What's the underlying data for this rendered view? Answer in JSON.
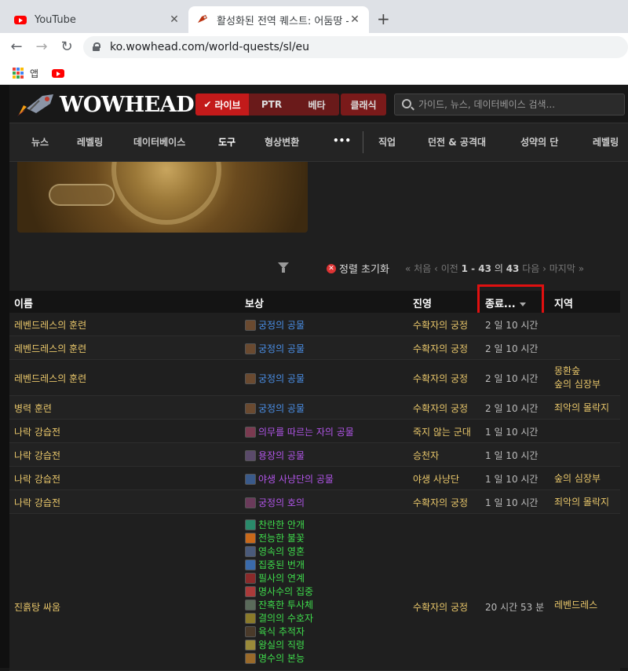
{
  "browser": {
    "tabs": [
      {
        "title": "YouTube",
        "icon": "youtube-icon"
      },
      {
        "title": "활성화된 전역 퀘스트: 어둠땅 -",
        "icon": "wowhead-icon"
      }
    ],
    "url": "ko.wowhead.com/world-quests/sl/eu",
    "bookmarks": [
      {
        "label": "앱"
      },
      {
        "label": ""
      }
    ]
  },
  "site": {
    "logo": "WOWHEAD",
    "versions": {
      "live": "라이브",
      "ptr": "PTR",
      "beta": "베타",
      "classic": "클래식"
    },
    "search_placeholder": "가이드, 뉴스, 데이터베이스 검색...",
    "nav": [
      "뉴스",
      "레벨링",
      "데이터베이스",
      "도구",
      "형상변환",
      "•••",
      "직업",
      "던전 & 공격대",
      "성약의 단",
      "레벨링"
    ]
  },
  "controls": {
    "reset": "정렬 초기화",
    "pager": {
      "first": "« 처음",
      "prev": "‹ 이전",
      "range": "1 - 43",
      "of": "의",
      "total": "43",
      "next": "다음 ›",
      "last": "마지막 »"
    }
  },
  "table": {
    "headers": {
      "name": "이름",
      "reward": "보상",
      "faction": "진영",
      "ends": "종료...",
      "zone": "지역"
    },
    "rows": [
      {
        "name": "레벤드레스의 훈련",
        "reward": "궁정의 공물",
        "reward_color": "blue",
        "faction": "수확자의 궁정",
        "time": "2 일 10 시간",
        "zone": ""
      },
      {
        "name": "레벤드레스의 훈련",
        "reward": "궁정의 공물",
        "reward_color": "blue",
        "faction": "수확자의 궁정",
        "time": "2 일 10 시간",
        "zone": ""
      },
      {
        "name": "레벤드레스의 훈련",
        "reward": "궁정의 공물",
        "reward_color": "blue",
        "faction": "수확자의 궁정",
        "time": "2 일 10 시간",
        "zone": "몽환숲",
        "zone2": "숲의 심장부"
      },
      {
        "name": "병력 훈련",
        "reward": "궁정의 공물",
        "reward_color": "blue",
        "faction": "수확자의 궁정",
        "time": "2 일 10 시간",
        "zone": "죄악의 몰락지"
      },
      {
        "name": "나락 강습전",
        "reward": "의무를 따르는 자의 공물",
        "reward_color": "purple",
        "faction": "죽지 않는 군대",
        "time": "1 일 10 시간",
        "zone": ""
      },
      {
        "name": "나락 강습전",
        "reward": "용장의 공물",
        "reward_color": "purple",
        "faction": "승천자",
        "time": "1 일 10 시간",
        "zone": ""
      },
      {
        "name": "나락 강습전",
        "reward": "야생 사냥단의 공물",
        "reward_color": "purple",
        "faction": "야생 사냥단",
        "time": "1 일 10 시간",
        "zone": "숲의 심장부"
      },
      {
        "name": "나락 강습전",
        "reward": "궁정의 호의",
        "reward_color": "purple",
        "faction": "수확자의 궁정",
        "time": "1 일 10 시간",
        "zone": "죄악의 몰락지"
      }
    ],
    "big_row": {
      "name": "진흙탕 싸움",
      "faction": "수확자의 궁정",
      "time": "20 시간 53 분",
      "zone": "레벤드레스",
      "rewards": [
        "찬란한 안개",
        "전능한 불꽃",
        "영속의 영혼",
        "집중된 번개",
        "필사의 연계",
        "명사수의 집중",
        "잔혹한 투사체",
        "결의의 수호자",
        "육식 추적자",
        "왕실의 직령",
        "명수의 본능"
      ]
    }
  },
  "colors": {
    "highlight": "#e01010",
    "quest": "#e8c66a",
    "blue": "#4a8fe7",
    "purple": "#b155e8",
    "green": "#3fdc4c"
  }
}
